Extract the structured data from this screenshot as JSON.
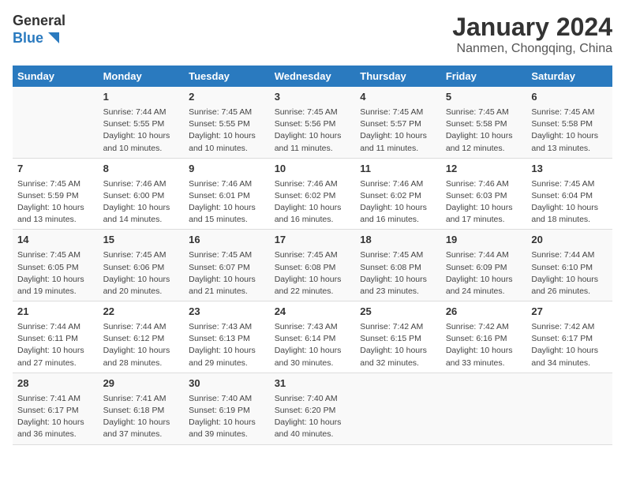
{
  "header": {
    "logo_general": "General",
    "logo_blue": "Blue",
    "title": "January 2024",
    "subtitle": "Nanmen, Chongqing, China"
  },
  "columns": [
    "Sunday",
    "Monday",
    "Tuesday",
    "Wednesday",
    "Thursday",
    "Friday",
    "Saturday"
  ],
  "weeks": [
    [
      {
        "num": "",
        "info": ""
      },
      {
        "num": "1",
        "info": "Sunrise: 7:44 AM\nSunset: 5:55 PM\nDaylight: 10 hours and 10 minutes."
      },
      {
        "num": "2",
        "info": "Sunrise: 7:45 AM\nSunset: 5:55 PM\nDaylight: 10 hours and 10 minutes."
      },
      {
        "num": "3",
        "info": "Sunrise: 7:45 AM\nSunset: 5:56 PM\nDaylight: 10 hours and 11 minutes."
      },
      {
        "num": "4",
        "info": "Sunrise: 7:45 AM\nSunset: 5:57 PM\nDaylight: 10 hours and 11 minutes."
      },
      {
        "num": "5",
        "info": "Sunrise: 7:45 AM\nSunset: 5:58 PM\nDaylight: 10 hours and 12 minutes."
      },
      {
        "num": "6",
        "info": "Sunrise: 7:45 AM\nSunset: 5:58 PM\nDaylight: 10 hours and 13 minutes."
      }
    ],
    [
      {
        "num": "7",
        "info": "Sunrise: 7:45 AM\nSunset: 5:59 PM\nDaylight: 10 hours and 13 minutes."
      },
      {
        "num": "8",
        "info": "Sunrise: 7:46 AM\nSunset: 6:00 PM\nDaylight: 10 hours and 14 minutes."
      },
      {
        "num": "9",
        "info": "Sunrise: 7:46 AM\nSunset: 6:01 PM\nDaylight: 10 hours and 15 minutes."
      },
      {
        "num": "10",
        "info": "Sunrise: 7:46 AM\nSunset: 6:02 PM\nDaylight: 10 hours and 16 minutes."
      },
      {
        "num": "11",
        "info": "Sunrise: 7:46 AM\nSunset: 6:02 PM\nDaylight: 10 hours and 16 minutes."
      },
      {
        "num": "12",
        "info": "Sunrise: 7:46 AM\nSunset: 6:03 PM\nDaylight: 10 hours and 17 minutes."
      },
      {
        "num": "13",
        "info": "Sunrise: 7:45 AM\nSunset: 6:04 PM\nDaylight: 10 hours and 18 minutes."
      }
    ],
    [
      {
        "num": "14",
        "info": "Sunrise: 7:45 AM\nSunset: 6:05 PM\nDaylight: 10 hours and 19 minutes."
      },
      {
        "num": "15",
        "info": "Sunrise: 7:45 AM\nSunset: 6:06 PM\nDaylight: 10 hours and 20 minutes."
      },
      {
        "num": "16",
        "info": "Sunrise: 7:45 AM\nSunset: 6:07 PM\nDaylight: 10 hours and 21 minutes."
      },
      {
        "num": "17",
        "info": "Sunrise: 7:45 AM\nSunset: 6:08 PM\nDaylight: 10 hours and 22 minutes."
      },
      {
        "num": "18",
        "info": "Sunrise: 7:45 AM\nSunset: 6:08 PM\nDaylight: 10 hours and 23 minutes."
      },
      {
        "num": "19",
        "info": "Sunrise: 7:44 AM\nSunset: 6:09 PM\nDaylight: 10 hours and 24 minutes."
      },
      {
        "num": "20",
        "info": "Sunrise: 7:44 AM\nSunset: 6:10 PM\nDaylight: 10 hours and 26 minutes."
      }
    ],
    [
      {
        "num": "21",
        "info": "Sunrise: 7:44 AM\nSunset: 6:11 PM\nDaylight: 10 hours and 27 minutes."
      },
      {
        "num": "22",
        "info": "Sunrise: 7:44 AM\nSunset: 6:12 PM\nDaylight: 10 hours and 28 minutes."
      },
      {
        "num": "23",
        "info": "Sunrise: 7:43 AM\nSunset: 6:13 PM\nDaylight: 10 hours and 29 minutes."
      },
      {
        "num": "24",
        "info": "Sunrise: 7:43 AM\nSunset: 6:14 PM\nDaylight: 10 hours and 30 minutes."
      },
      {
        "num": "25",
        "info": "Sunrise: 7:42 AM\nSunset: 6:15 PM\nDaylight: 10 hours and 32 minutes."
      },
      {
        "num": "26",
        "info": "Sunrise: 7:42 AM\nSunset: 6:16 PM\nDaylight: 10 hours and 33 minutes."
      },
      {
        "num": "27",
        "info": "Sunrise: 7:42 AM\nSunset: 6:17 PM\nDaylight: 10 hours and 34 minutes."
      }
    ],
    [
      {
        "num": "28",
        "info": "Sunrise: 7:41 AM\nSunset: 6:17 PM\nDaylight: 10 hours and 36 minutes."
      },
      {
        "num": "29",
        "info": "Sunrise: 7:41 AM\nSunset: 6:18 PM\nDaylight: 10 hours and 37 minutes."
      },
      {
        "num": "30",
        "info": "Sunrise: 7:40 AM\nSunset: 6:19 PM\nDaylight: 10 hours and 39 minutes."
      },
      {
        "num": "31",
        "info": "Sunrise: 7:40 AM\nSunset: 6:20 PM\nDaylight: 10 hours and 40 minutes."
      },
      {
        "num": "",
        "info": ""
      },
      {
        "num": "",
        "info": ""
      },
      {
        "num": "",
        "info": ""
      }
    ]
  ]
}
